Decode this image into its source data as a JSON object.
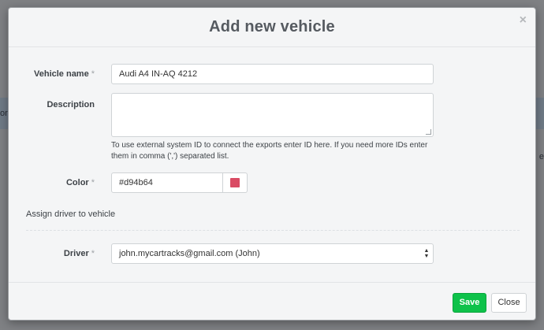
{
  "background": {
    "left_fragment": "or",
    "right_fragment": "e"
  },
  "modal": {
    "title": "Add new vehicle",
    "close_glyph": "×",
    "fields": {
      "vehicle_name": {
        "label": "Vehicle name",
        "required_mark": "*",
        "value": "Audi A4 IN-AQ 4212"
      },
      "description": {
        "label": "Description",
        "value": "",
        "help": "To use external system ID to connect the exports enter ID here. If you need more IDs enter them in comma (',') separated list."
      },
      "color": {
        "label": "Color",
        "required_mark": "*",
        "value": "#d94b64",
        "swatch_color": "#d94b64"
      }
    },
    "section": {
      "title": "Assign driver to vehicle"
    },
    "driver": {
      "label": "Driver",
      "required_mark": "*",
      "selected": "john.mycartracks@gmail.com (John)"
    },
    "footer": {
      "save_label": "Save",
      "close_label": "Close"
    }
  },
  "colors": {
    "save_button": "#0ec24a",
    "overlay": "#7f8184"
  },
  "icons": {
    "close": "close-icon",
    "select_arrows": "select-arrows-icon"
  }
}
